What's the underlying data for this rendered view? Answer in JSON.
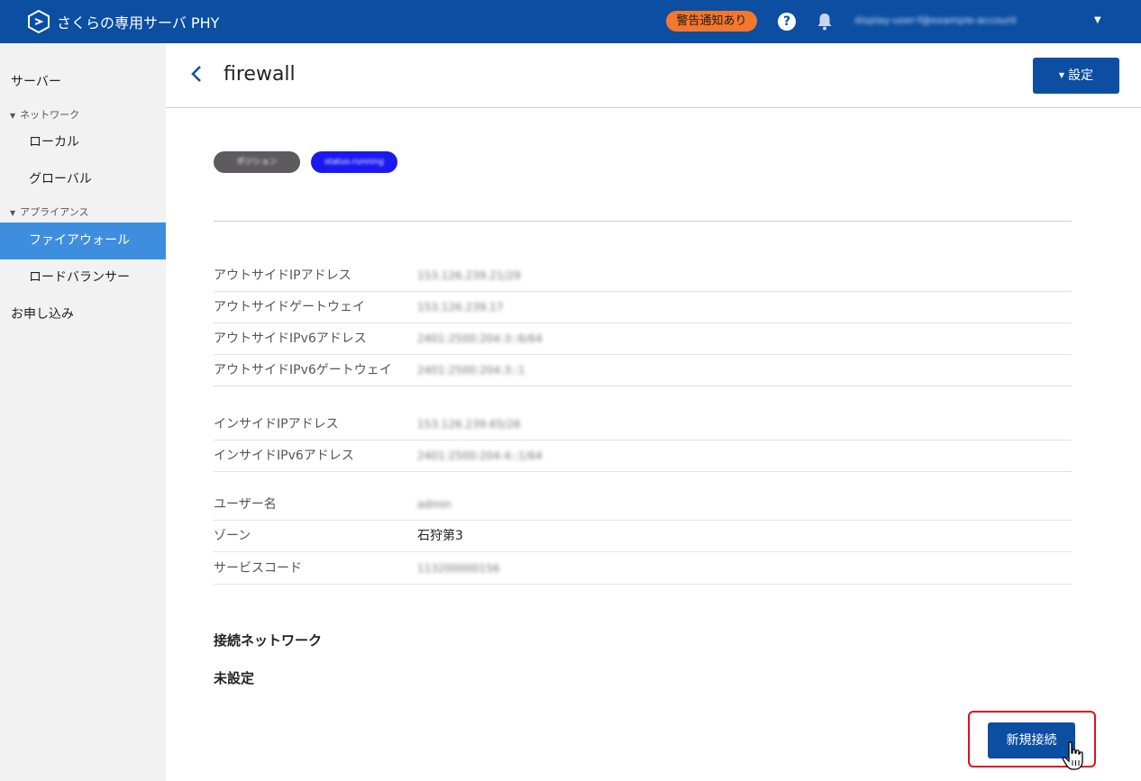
{
  "header": {
    "app_name": "さくらの専用サーバ PHY",
    "alert_badge": "警告通知あり",
    "help_glyph": "?",
    "account_label": "display-user-f@example-account",
    "account_caret": "▼",
    "brand_color": "#0b4ea2",
    "alert_color": "#f5772d"
  },
  "sidebar": {
    "items": [
      {
        "label": "サーバー"
      },
      {
        "label": "ネットワーク",
        "caret": "▼"
      },
      {
        "label": "ローカル"
      },
      {
        "label": "グローバル"
      },
      {
        "label": "アプライアンス",
        "caret": "▼"
      },
      {
        "label": "ファイアウォール",
        "active": true
      },
      {
        "label": "ロードバランサー"
      },
      {
        "label": "お申し込み"
      }
    ],
    "active_color": "#3e8ee0"
  },
  "page": {
    "back_icon": "chevron-left-icon",
    "title": "firewall",
    "settings_caret": "▼",
    "settings_label": "設定"
  },
  "tags": [
    {
      "label": "ポジション",
      "color": "#5d5a60"
    },
    {
      "label": "status-running",
      "color": "#1a19f0"
    }
  ],
  "details": {
    "outside": [
      {
        "label": "アウトサイドIPアドレス",
        "value": "153.126.239.21/29"
      },
      {
        "label": "アウトサイドゲートウェイ",
        "value": "153.126.239.17"
      },
      {
        "label": "アウトサイドIPv6アドレス",
        "value": "2401:2500:204:3::6/64"
      },
      {
        "label": "アウトサイドIPv6ゲートウェイ",
        "value": "2401:2500:204:3::1"
      }
    ],
    "inside": [
      {
        "label": "インサイドIPアドレス",
        "value": "153.126.239.65/26"
      },
      {
        "label": "インサイドIPv6アドレス",
        "value": "2401:2500:204:4::1/64"
      }
    ],
    "info": [
      {
        "label": "ユーザー名",
        "value": "admin"
      },
      {
        "label": "ゾーン",
        "value": "石狩第3"
      },
      {
        "label": "サービスコード",
        "value": "113200000156"
      }
    ]
  },
  "connection": {
    "heading": "接続ネットワーク",
    "status": "未設定",
    "new_button": "新規接続"
  }
}
